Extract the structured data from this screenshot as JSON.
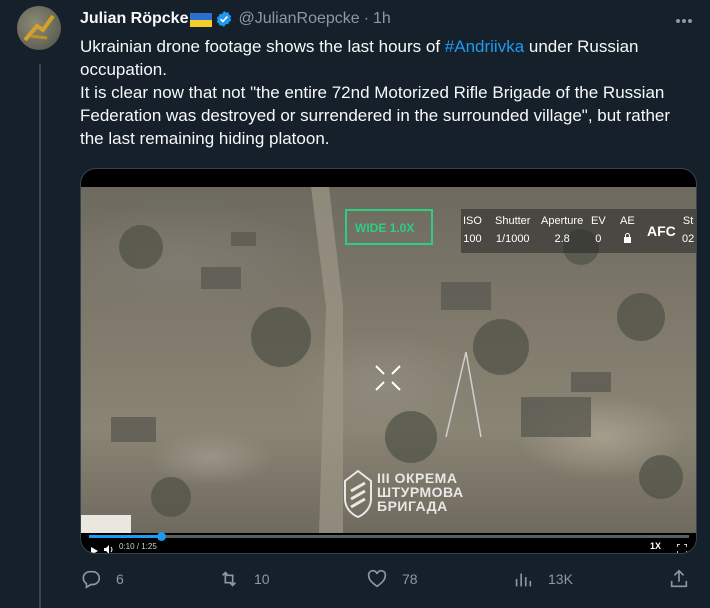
{
  "author": {
    "name": "Julian Röpcke",
    "handle": "@JulianRoepcke",
    "separator": "·",
    "time": "1h"
  },
  "tweet": {
    "line1_pre": "Ukrainian drone footage shows the last hours of ",
    "hashtag": "#Andriivka",
    "line1_post": " under Russian occupation.",
    "paragraph2": "It is clear now that not \"the entire 72nd Motorized Rifle Brigade of the Russian Federation was destroyed or surrendered in the surrounded village\", but rather the last remaining hiding platoon."
  },
  "video": {
    "hud_wide": "WIDE 1.0X",
    "stats": [
      {
        "key": "ISO",
        "value": "100"
      },
      {
        "key": "Shutter",
        "value": "1/1000"
      },
      {
        "key": "Aperture",
        "value": "2.8"
      },
      {
        "key": "EV",
        "value": "0"
      },
      {
        "key": "AE",
        "value": ""
      },
      {
        "key": "St",
        "value": "02"
      }
    ],
    "afc": "AFC",
    "watermark": [
      "III ОКРЕМА",
      "ШТУРМОВА",
      "БРИГАДА"
    ],
    "time_readout": "0:10 / 1:25",
    "progress": 0.12,
    "speed": "1X"
  },
  "actions": {
    "replies": "6",
    "reposts": "10",
    "likes": "78",
    "views": "13K"
  },
  "colors": {
    "background": "#15202b",
    "accent": "#1d9bf0",
    "muted": "#8b98a5",
    "hud_green": "#2ccf80"
  }
}
